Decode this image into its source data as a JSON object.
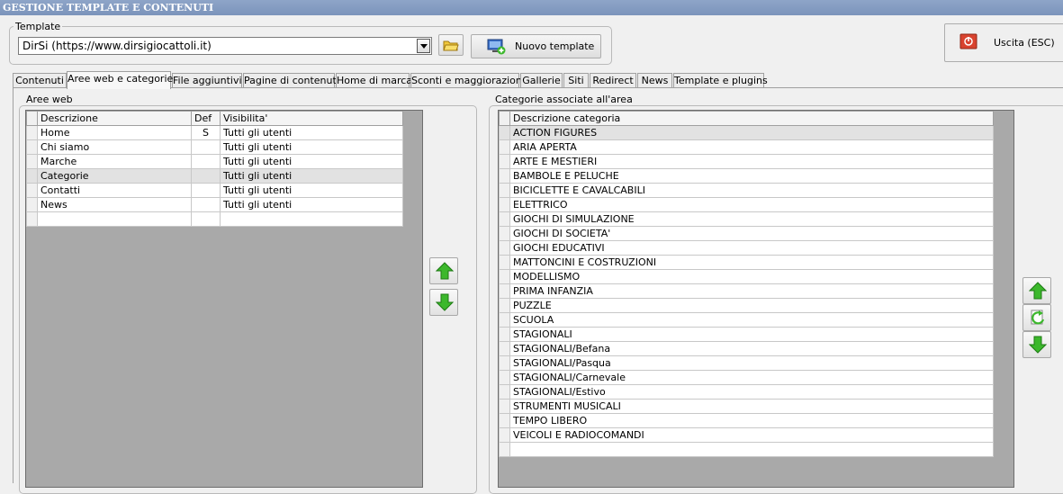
{
  "window": {
    "title": "GESTIONE TEMPLATE E CONTENUTI"
  },
  "template": {
    "group_label": "Template",
    "selected": "DirSi (https://www.dirsigiocattoli.it)",
    "new_label": "Nuovo template"
  },
  "exit": {
    "label": "Uscita (ESC)"
  },
  "tabs": [
    {
      "label": "Contenuti"
    },
    {
      "label": "Aree web e categorie"
    },
    {
      "label": "File aggiuntivi"
    },
    {
      "label": "Pagine di contenuti"
    },
    {
      "label": "Home di marca"
    },
    {
      "label": "Sconti e maggiorazioni"
    },
    {
      "label": "Gallerie"
    },
    {
      "label": "Siti"
    },
    {
      "label": "Redirect"
    },
    {
      "label": "News"
    },
    {
      "label": "Template e plugins"
    }
  ],
  "active_tab": "Aree web e categorie",
  "aree": {
    "group_label": "Aree web",
    "columns": {
      "descrizione": "Descrizione",
      "def": "Def",
      "visibilita": "Visibilita'"
    },
    "rows": [
      {
        "descrizione": "Home",
        "def": "S",
        "visibilita": "Tutti gli utenti"
      },
      {
        "descrizione": "Chi siamo",
        "def": "",
        "visibilita": "Tutti gli utenti"
      },
      {
        "descrizione": "Marche",
        "def": "",
        "visibilita": "Tutti gli utenti"
      },
      {
        "descrizione": "Categorie",
        "def": "",
        "visibilita": "Tutti gli utenti"
      },
      {
        "descrizione": "Contatti",
        "def": "",
        "visibilita": "Tutti gli utenti"
      },
      {
        "descrizione": "News",
        "def": "",
        "visibilita": "Tutti gli utenti"
      }
    ],
    "selected_row": "Categorie"
  },
  "categorie": {
    "group_label": "Categorie associate all'area",
    "column": "Descrizione categoria",
    "rows": [
      "ACTION FIGURES",
      "ARIA APERTA",
      "ARTE E MESTIERI",
      "BAMBOLE E PELUCHE",
      "BICICLETTE E CAVALCABILI",
      "ELETTRICO",
      "GIOCHI DI SIMULAZIONE",
      "GIOCHI DI SOCIETA'",
      "GIOCHI EDUCATIVI",
      "MATTONCINI E COSTRUZIONI",
      "MODELLISMO",
      "PRIMA INFANZIA",
      "PUZZLE",
      "SCUOLA",
      "STAGIONALI",
      "STAGIONALI/Befana",
      "STAGIONALI/Pasqua",
      "STAGIONALI/Carnevale",
      "STAGIONALI/Estivo",
      "STRUMENTI MUSICALI",
      "TEMPO LIBERO",
      "VEICOLI E RADIOCOMANDI"
    ],
    "selected_row": "ACTION FIGURES"
  },
  "icons": {
    "move_up": "green-arrow-up-icon",
    "move_down": "green-arrow-down-icon",
    "refresh": "refresh-icon",
    "folder": "folder-icon",
    "new_template": "monitor-add-icon",
    "exit": "power-off-icon"
  },
  "colors": {
    "titlebar": "#7b94bb",
    "arrow_green": "#3cb82c",
    "exit_red": "#d9432f"
  }
}
